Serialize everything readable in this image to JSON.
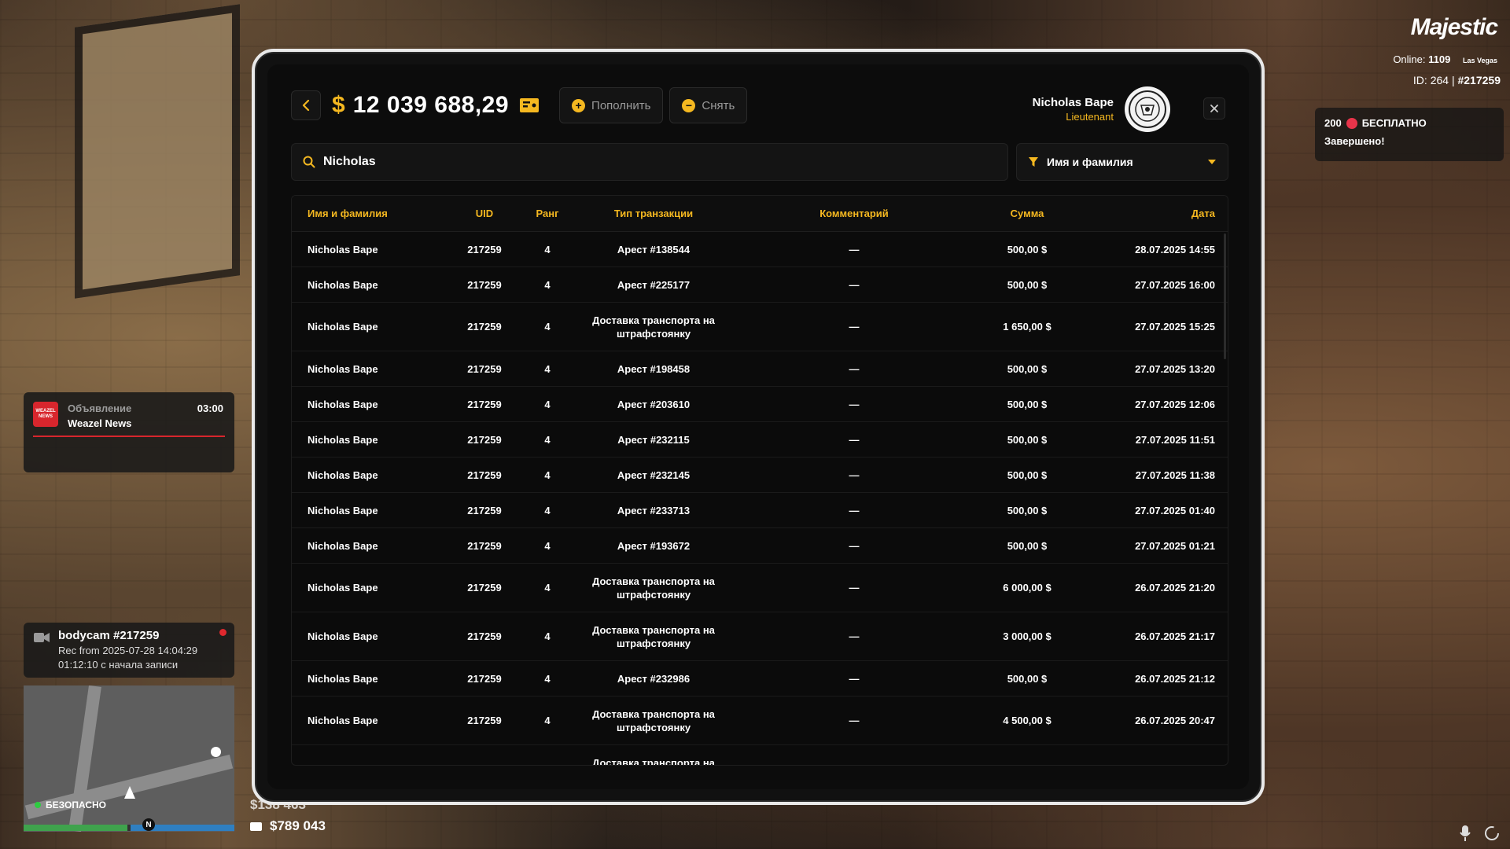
{
  "hud": {
    "logo": "Majestic",
    "online_label": "Online:",
    "online_count": "1109",
    "city": "Las Vegas",
    "id_label": "ID: 264 |",
    "player_id": "#217259"
  },
  "promo": {
    "amount": "200",
    "label": "БЕСПЛАТНО",
    "status": "Завершено!"
  },
  "news": {
    "logo_text": "WEAZEL NEWS",
    "title": "Объявление",
    "source": "Weazel News",
    "time": "03:00"
  },
  "bodycam": {
    "title": "bodycam #217259",
    "rec": "Rec from 2025-07-28 14:04:29",
    "elapsed": "01:12:10 с начала записи"
  },
  "status": {
    "safe": "БЕЗОПАСНО",
    "compass": "N"
  },
  "money": {
    "cash": "$138 463",
    "bank": "$789 043"
  },
  "tablet": {
    "currency": "$",
    "balance": "12 039 688,29",
    "deposit_label": "Пополнить",
    "withdraw_label": "Снять",
    "user_name": "Nicholas Bape",
    "user_rank": "Lieutenant",
    "search_value": "Nicholas",
    "filter_label": "Имя и фамилия",
    "columns": {
      "name": "Имя и фамилия",
      "uid": "UID",
      "rank": "Ранг",
      "type": "Тип транзакции",
      "comment": "Комментарий",
      "sum": "Сумма",
      "date": "Дата"
    },
    "rows": [
      {
        "name": "Nicholas Bape",
        "uid": "217259",
        "rank": "4",
        "type": "Арест #138544",
        "comment": "—",
        "sum": "500,00 $",
        "date": "28.07.2025 14:55"
      },
      {
        "name": "Nicholas Bape",
        "uid": "217259",
        "rank": "4",
        "type": "Арест #225177",
        "comment": "—",
        "sum": "500,00 $",
        "date": "27.07.2025 16:00"
      },
      {
        "name": "Nicholas Bape",
        "uid": "217259",
        "rank": "4",
        "type": "Доставка транспорта на штрафстоянку",
        "comment": "—",
        "sum": "1 650,00 $",
        "date": "27.07.2025 15:25"
      },
      {
        "name": "Nicholas Bape",
        "uid": "217259",
        "rank": "4",
        "type": "Арест #198458",
        "comment": "—",
        "sum": "500,00 $",
        "date": "27.07.2025 13:20"
      },
      {
        "name": "Nicholas Bape",
        "uid": "217259",
        "rank": "4",
        "type": "Арест #203610",
        "comment": "—",
        "sum": "500,00 $",
        "date": "27.07.2025 12:06"
      },
      {
        "name": "Nicholas Bape",
        "uid": "217259",
        "rank": "4",
        "type": "Арест #232115",
        "comment": "—",
        "sum": "500,00 $",
        "date": "27.07.2025 11:51"
      },
      {
        "name": "Nicholas Bape",
        "uid": "217259",
        "rank": "4",
        "type": "Арест #232145",
        "comment": "—",
        "sum": "500,00 $",
        "date": "27.07.2025 11:38"
      },
      {
        "name": "Nicholas Bape",
        "uid": "217259",
        "rank": "4",
        "type": "Арест #233713",
        "comment": "—",
        "sum": "500,00 $",
        "date": "27.07.2025 01:40"
      },
      {
        "name": "Nicholas Bape",
        "uid": "217259",
        "rank": "4",
        "type": "Арест #193672",
        "comment": "—",
        "sum": "500,00 $",
        "date": "27.07.2025 01:21"
      },
      {
        "name": "Nicholas Bape",
        "uid": "217259",
        "rank": "4",
        "type": "Доставка транспорта на штрафстоянку",
        "comment": "—",
        "sum": "6 000,00 $",
        "date": "26.07.2025 21:20"
      },
      {
        "name": "Nicholas Bape",
        "uid": "217259",
        "rank": "4",
        "type": "Доставка транспорта на штрафстоянку",
        "comment": "—",
        "sum": "3 000,00 $",
        "date": "26.07.2025 21:17"
      },
      {
        "name": "Nicholas Bape",
        "uid": "217259",
        "rank": "4",
        "type": "Арест #232986",
        "comment": "—",
        "sum": "500,00 $",
        "date": "26.07.2025 21:12"
      },
      {
        "name": "Nicholas Bape",
        "uid": "217259",
        "rank": "4",
        "type": "Доставка транспорта на штрафстоянку",
        "comment": "—",
        "sum": "4 500,00 $",
        "date": "26.07.2025 20:47"
      },
      {
        "name": "",
        "uid": "",
        "rank": "",
        "type": "Доставка транспорта на",
        "comment": "",
        "sum": "",
        "date": ""
      }
    ]
  },
  "colors": {
    "accent": "#f5b820",
    "danger": "#e0282e",
    "panel": "#0c0c0c"
  }
}
